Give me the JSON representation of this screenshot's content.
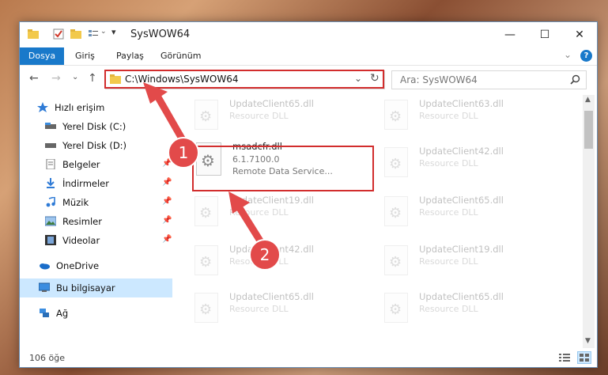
{
  "window": {
    "title": "SysWOW64",
    "minimize": "—",
    "maximize": "☐",
    "close": "✕"
  },
  "ribbon": {
    "tabs": [
      "Dosya",
      "Giriş",
      "Paylaş",
      "Görünüm"
    ],
    "expand": "⌄",
    "help": "?"
  },
  "nav": {
    "back": "←",
    "forward": "→",
    "recent": "⌄",
    "up": "↑"
  },
  "address": {
    "path": "C:\\Windows\\SysWOW64",
    "dropdown": "⌄",
    "refresh": "↻"
  },
  "search": {
    "placeholder": "Ara: SysWOW64",
    "icon": "search-icon"
  },
  "sidebar": {
    "items": [
      {
        "label": "Hızlı erişim",
        "icon": "star-icon"
      },
      {
        "label": "Yerel Disk (C:)",
        "icon": "drive-icon",
        "pinned": true
      },
      {
        "label": "Yerel Disk (D:)",
        "icon": "drive-icon",
        "pinned": true
      },
      {
        "label": "Belgeler",
        "icon": "documents-icon",
        "pinned": true
      },
      {
        "label": "İndirmeler",
        "icon": "downloads-icon",
        "pinned": true
      },
      {
        "label": "Müzik",
        "icon": "music-icon",
        "pinned": true
      },
      {
        "label": "Resimler",
        "icon": "pictures-icon",
        "pinned": true
      },
      {
        "label": "Videolar",
        "icon": "videos-icon",
        "pinned": true
      },
      {
        "label": "OneDrive",
        "icon": "cloud-icon"
      },
      {
        "label": "Bu bilgisayar",
        "icon": "computer-icon",
        "selected": true
      },
      {
        "label": "Ağ",
        "icon": "network-icon"
      }
    ],
    "pin_glyph": "📌"
  },
  "files": {
    "left": [
      {
        "name": "UpdateClient65.dll",
        "type": "Resource DLL"
      },
      {
        "name": "UpdateClient19.dll",
        "type": "Resource DLL"
      },
      {
        "name": "UpdateClient42.dll",
        "type": "Resource DLL"
      },
      {
        "name": "UpdateClient65.dll",
        "type": "Resource DLL"
      }
    ],
    "right": [
      {
        "name": "UpdateClient63.dll",
        "type": "Resource DLL"
      },
      {
        "name": "UpdateClient42.dll",
        "type": "Resource DLL"
      },
      {
        "name": "UpdateClient65.dll",
        "type": "Resource DLL"
      },
      {
        "name": "UpdateClient19.dll",
        "type": "Resource DLL"
      },
      {
        "name": "UpdateClient65.dll",
        "type": "Resource DLL"
      }
    ],
    "highlighted": {
      "name": "msadcfr.dll",
      "version": "6.1.7100.0",
      "description": "Remote Data Service..."
    }
  },
  "status": {
    "count": "106 öğe"
  },
  "annotations": {
    "step1": "1",
    "step2": "2",
    "color": "#e24a4a"
  }
}
